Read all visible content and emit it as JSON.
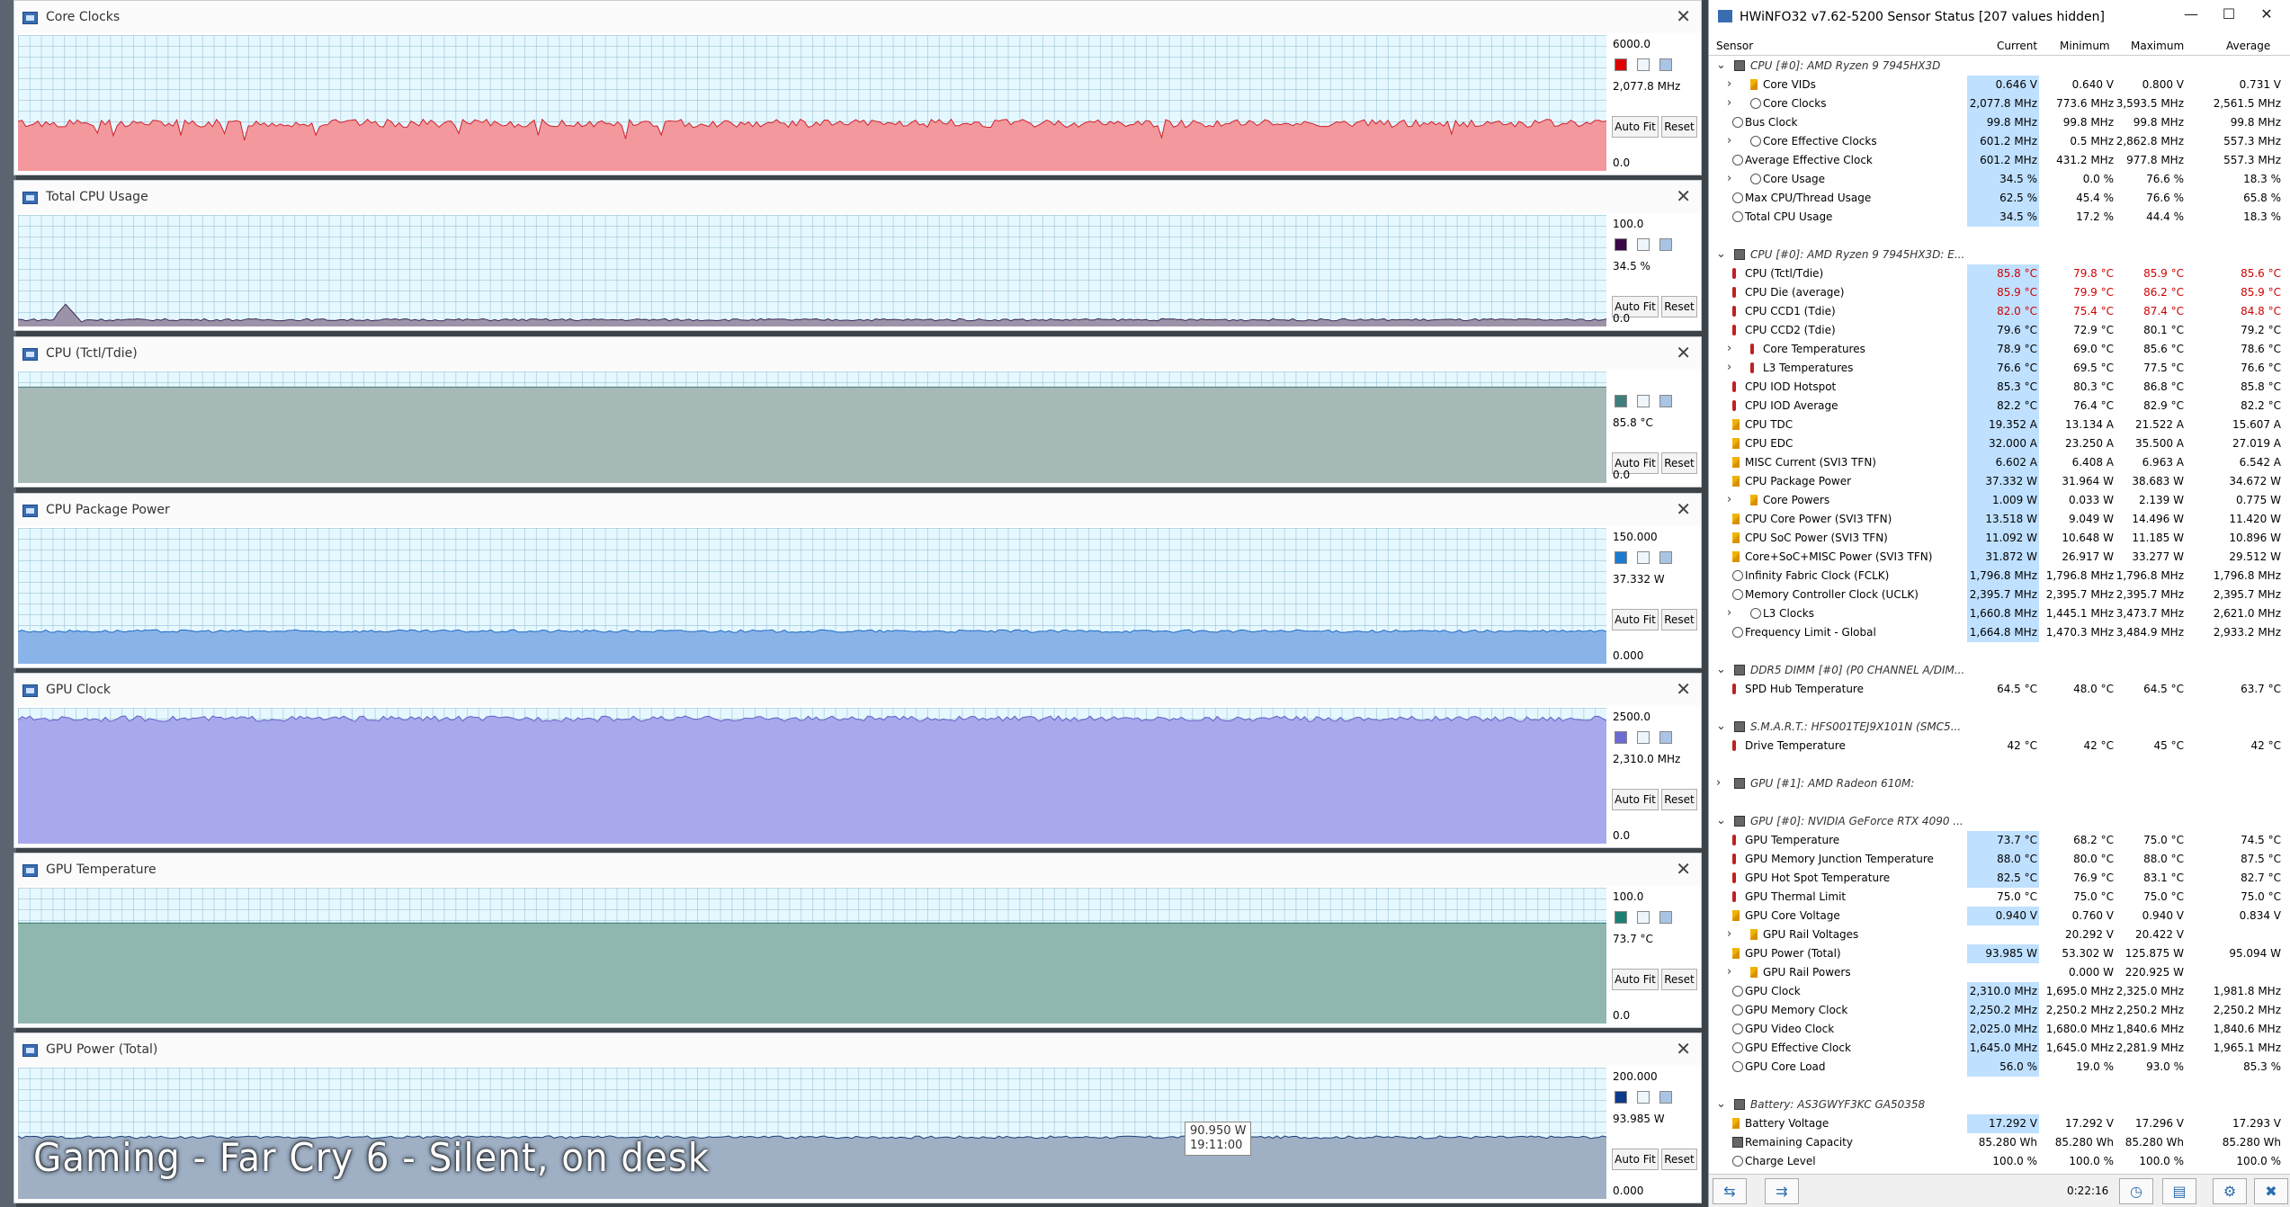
{
  "graphs": [
    {
      "title": "Core Clocks",
      "max": "6000.0",
      "current": "2,077.8 MHz",
      "min": "0.0",
      "fill": "#f3999d",
      "line": "#d0212b",
      "swatch": "#e00000",
      "level": 0.35,
      "noise": 0.03
    },
    {
      "title": "Total CPU Usage",
      "max": "100.0",
      "current": "34.5 %",
      "min": "0.0",
      "fill": "#9d93a8",
      "line": "#3a2a58",
      "swatch": "#3a0845",
      "level": 0.06,
      "noise": 0.01
    },
    {
      "title": "CPU (Tctl/Tdie)",
      "max": "",
      "current": "85.8 °C",
      "min": "0.0",
      "fill": "#a6b9b6",
      "line": "#4a7a73",
      "swatch": "#3e7f7c",
      "level": 0.86,
      "noise": 0.0
    },
    {
      "title": "CPU Package Power",
      "max": "150.000",
      "current": "37.332 W",
      "min": "0.000",
      "fill": "#8ab3e8",
      "line": "#1c6ac8",
      "swatch": "#1c7ad0",
      "level": 0.24,
      "noise": 0.01
    },
    {
      "title": "GPU Clock",
      "max": "2500.0",
      "current": "2,310.0 MHz",
      "min": "0.0",
      "fill": "#a8a8ec",
      "line": "#6060c8",
      "swatch": "#6b6bd0",
      "level": 0.92,
      "noise": 0.02
    },
    {
      "title": "GPU Temperature",
      "max": "100.0",
      "current": "73.7 °C",
      "min": "0.0",
      "fill": "#8fb6af",
      "line": "#2b7a6a",
      "swatch": "#1e8074",
      "level": 0.74,
      "noise": 0.0
    },
    {
      "title": "GPU Power (Total)",
      "max": "200.000",
      "current": "93.985 W",
      "min": "0.000",
      "fill": "#9fb0c5",
      "line": "#1a3f7a",
      "swatch": "#0d3a8a",
      "level": 0.47,
      "noise": 0.01
    }
  ],
  "buttons": {
    "autofit": "Auto Fit",
    "reset": "Reset"
  },
  "tooltip": {
    "value": "90.950 W",
    "time": "19:11:00"
  },
  "caption": "Gaming - Far Cry 6 - Silent, on desk",
  "hwinfo": {
    "title": "HWiNFO32 v7.62-5200 Sensor Status [207 values hidden]",
    "columns": {
      "sensor": "Sensor",
      "current": "Current",
      "minimum": "Minimum",
      "maximum": "Maximum",
      "average": "Average"
    },
    "timer": "0:22:16",
    "rows": [
      {
        "t": "g",
        "name": "CPU [#0]: AMD Ryzen 9 7945HX3D"
      },
      {
        "i": "volt",
        "x": 1,
        "name": "Core VIDs",
        "cur": "0.646 V",
        "min": "0.640 V",
        "max": "0.800 V",
        "avg": "0.731 V"
      },
      {
        "i": "clock",
        "x": 1,
        "name": "Core Clocks",
        "cur": "2,077.8 MHz",
        "min": "773.6 MHz",
        "max": "3,593.5 MHz",
        "avg": "2,561.5 MHz"
      },
      {
        "i": "clock",
        "name": "Bus Clock",
        "cur": "99.8 MHz",
        "min": "99.8 MHz",
        "max": "99.8 MHz",
        "avg": "99.8 MHz"
      },
      {
        "i": "clock",
        "x": 1,
        "name": "Core Effective Clocks",
        "cur": "601.2 MHz",
        "min": "0.5 MHz",
        "max": "2,862.8 MHz",
        "avg": "557.3 MHz"
      },
      {
        "i": "clock",
        "name": "Average Effective Clock",
        "cur": "601.2 MHz",
        "min": "431.2 MHz",
        "max": "977.8 MHz",
        "avg": "557.3 MHz"
      },
      {
        "i": "clock",
        "x": 1,
        "name": "Core Usage",
        "cur": "34.5 %",
        "min": "0.0 %",
        "max": "76.6 %",
        "avg": "18.3 %"
      },
      {
        "i": "clock",
        "name": "Max CPU/Thread Usage",
        "cur": "62.5 %",
        "min": "45.4 %",
        "max": "76.6 %",
        "avg": "65.8 %"
      },
      {
        "i": "clock",
        "name": "Total CPU Usage",
        "cur": "34.5 %",
        "min": "17.2 %",
        "max": "44.4 %",
        "avg": "18.3 %"
      },
      {
        "t": "s"
      },
      {
        "t": "g",
        "name": "CPU [#0]: AMD Ryzen 9 7945HX3D: E..."
      },
      {
        "i": "therm",
        "name": "CPU (Tctl/Tdie)",
        "cur": "85.8 °C",
        "min": "79.8 °C",
        "max": "85.9 °C",
        "avg": "85.6 °C",
        "red": 1
      },
      {
        "i": "therm",
        "name": "CPU Die (average)",
        "cur": "85.9 °C",
        "min": "79.9 °C",
        "max": "86.2 °C",
        "avg": "85.9 °C",
        "red": 1
      },
      {
        "i": "therm",
        "name": "CPU CCD1 (Tdie)",
        "cur": "82.0 °C",
        "min": "75.4 °C",
        "max": "87.4 °C",
        "avg": "84.8 °C",
        "red": 1
      },
      {
        "i": "therm",
        "name": "CPU CCD2 (Tdie)",
        "cur": "79.6 °C",
        "min": "72.9 °C",
        "max": "80.1 °C",
        "avg": "79.2 °C"
      },
      {
        "i": "therm",
        "x": 1,
        "name": "Core Temperatures",
        "cur": "78.9 °C",
        "min": "69.0 °C",
        "max": "85.6 °C",
        "avg": "78.6 °C"
      },
      {
        "i": "therm",
        "x": 1,
        "name": "L3 Temperatures",
        "cur": "76.6 °C",
        "min": "69.5 °C",
        "max": "77.5 °C",
        "avg": "76.6 °C"
      },
      {
        "i": "therm",
        "name": "CPU IOD Hotspot",
        "cur": "85.3 °C",
        "min": "80.3 °C",
        "max": "86.8 °C",
        "avg": "85.8 °C"
      },
      {
        "i": "therm",
        "name": "CPU IOD Average",
        "cur": "82.2 °C",
        "min": "76.4 °C",
        "max": "82.9 °C",
        "avg": "82.2 °C"
      },
      {
        "i": "volt",
        "name": "CPU TDC",
        "cur": "19.352 A",
        "min": "13.134 A",
        "max": "21.522 A",
        "avg": "15.607 A"
      },
      {
        "i": "volt",
        "name": "CPU EDC",
        "cur": "32.000 A",
        "min": "23.250 A",
        "max": "35.500 A",
        "avg": "27.019 A"
      },
      {
        "i": "volt",
        "name": "MISC Current (SVI3 TFN)",
        "cur": "6.602 A",
        "min": "6.408 A",
        "max": "6.963 A",
        "avg": "6.542 A"
      },
      {
        "i": "volt",
        "name": "CPU Package Power",
        "cur": "37.332 W",
        "min": "31.964 W",
        "max": "38.683 W",
        "avg": "34.672 W"
      },
      {
        "i": "volt",
        "x": 1,
        "name": "Core Powers",
        "cur": "1.009 W",
        "min": "0.033 W",
        "max": "2.139 W",
        "avg": "0.775 W"
      },
      {
        "i": "volt",
        "name": "CPU Core Power (SVI3 TFN)",
        "cur": "13.518 W",
        "min": "9.049 W",
        "max": "14.496 W",
        "avg": "11.420 W"
      },
      {
        "i": "volt",
        "name": "CPU SoC Power (SVI3 TFN)",
        "cur": "11.092 W",
        "min": "10.648 W",
        "max": "11.185 W",
        "avg": "10.896 W"
      },
      {
        "i": "volt",
        "name": "Core+SoC+MISC Power (SVI3 TFN)",
        "cur": "31.872 W",
        "min": "26.917 W",
        "max": "33.277 W",
        "avg": "29.512 W"
      },
      {
        "i": "clock",
        "name": "Infinity Fabric Clock (FCLK)",
        "cur": "1,796.8 MHz",
        "min": "1,796.8 MHz",
        "max": "1,796.8 MHz",
        "avg": "1,796.8 MHz"
      },
      {
        "i": "clock",
        "name": "Memory Controller Clock (UCLK)",
        "cur": "2,395.7 MHz",
        "min": "2,395.7 MHz",
        "max": "2,395.7 MHz",
        "avg": "2,395.7 MHz"
      },
      {
        "i": "clock",
        "x": 1,
        "name": "L3 Clocks",
        "cur": "1,660.8 MHz",
        "min": "1,445.1 MHz",
        "max": "3,473.7 MHz",
        "avg": "2,621.0 MHz"
      },
      {
        "i": "clock",
        "name": "Frequency Limit - Global",
        "cur": "1,664.8 MHz",
        "min": "1,470.3 MHz",
        "max": "3,484.9 MHz",
        "avg": "2,933.2 MHz"
      },
      {
        "t": "s"
      },
      {
        "t": "g",
        "name": "DDR5 DIMM [#0] (P0 CHANNEL A/DIM..."
      },
      {
        "i": "therm",
        "name": "SPD Hub Temperature",
        "cur": "64.5 °C",
        "min": "48.0 °C",
        "max": "64.5 °C",
        "avg": "63.7 °C",
        "nobg": 1
      },
      {
        "t": "s"
      },
      {
        "t": "g",
        "name": "S.M.A.R.T.: HFS001TEJ9X101N (SMC5..."
      },
      {
        "i": "therm",
        "name": "Drive Temperature",
        "cur": "42 °C",
        "min": "42 °C",
        "max": "45 °C",
        "avg": "42 °C",
        "nobg": 1
      },
      {
        "t": "s"
      },
      {
        "t": "gc",
        "name": "GPU [#1]: AMD Radeon 610M:"
      },
      {
        "t": "s"
      },
      {
        "t": "g",
        "name": "GPU [#0]: NVIDIA GeForce RTX 4090 ..."
      },
      {
        "i": "therm",
        "name": "GPU Temperature",
        "cur": "73.7 °C",
        "min": "68.2 °C",
        "max": "75.0 °C",
        "avg": "74.5 °C"
      },
      {
        "i": "therm",
        "name": "GPU Memory Junction Temperature",
        "cur": "88.0 °C",
        "min": "80.0 °C",
        "max": "88.0 °C",
        "avg": "87.5 °C"
      },
      {
        "i": "therm",
        "name": "GPU Hot Spot Temperature",
        "cur": "82.5 °C",
        "min": "76.9 °C",
        "max": "83.1 °C",
        "avg": "82.7 °C"
      },
      {
        "i": "therm",
        "name": "GPU Thermal Limit",
        "cur": "75.0 °C",
        "min": "75.0 °C",
        "max": "75.0 °C",
        "avg": "75.0 °C",
        "nobg": 1
      },
      {
        "i": "volt",
        "name": "GPU Core Voltage",
        "cur": "0.940 V",
        "min": "0.760 V",
        "max": "0.940 V",
        "avg": "0.834 V"
      },
      {
        "i": "volt",
        "x": 1,
        "name": "GPU Rail Voltages",
        "cur": "",
        "min": "20.292 V",
        "max": "20.422 V",
        "avg": ""
      },
      {
        "i": "volt",
        "name": "GPU Power (Total)",
        "cur": "93.985 W",
        "min": "53.302 W",
        "max": "125.875 W",
        "avg": "95.094 W"
      },
      {
        "i": "volt",
        "x": 1,
        "name": "GPU Rail Powers",
        "cur": "",
        "min": "0.000 W",
        "max": "220.925 W",
        "avg": ""
      },
      {
        "i": "clock",
        "name": "GPU Clock",
        "cur": "2,310.0 MHz",
        "min": "1,695.0 MHz",
        "max": "2,325.0 MHz",
        "avg": "1,981.8 MHz"
      },
      {
        "i": "clock",
        "name": "GPU Memory Clock",
        "cur": "2,250.2 MHz",
        "min": "2,250.2 MHz",
        "max": "2,250.2 MHz",
        "avg": "2,250.2 MHz"
      },
      {
        "i": "clock",
        "name": "GPU Video Clock",
        "cur": "2,025.0 MHz",
        "min": "1,680.0 MHz",
        "max": "1,840.6 MHz",
        "avg": "1,840.6 MHz"
      },
      {
        "i": "clock",
        "name": "GPU Effective Clock",
        "cur": "1,645.0 MHz",
        "min": "1,645.0 MHz",
        "max": "2,281.9 MHz",
        "avg": "1,965.1 MHz"
      },
      {
        "i": "clock",
        "name": "GPU Core Load",
        "cur": "56.0 %",
        "min": "19.0 %",
        "max": "93.0 %",
        "avg": "85.3 %"
      },
      {
        "t": "s"
      },
      {
        "t": "g",
        "name": "Battery: AS3GWYF3KC GA50358"
      },
      {
        "i": "volt",
        "name": "Battery Voltage",
        "cur": "17.292 V",
        "min": "17.292 V",
        "max": "17.296 V",
        "avg": "17.293 V"
      },
      {
        "i": "chip",
        "name": "Remaining Capacity",
        "cur": "85.280 Wh",
        "min": "85.280 Wh",
        "max": "85.280 Wh",
        "avg": "85.280 Wh",
        "nobg": 1
      },
      {
        "i": "clock",
        "name": "Charge Level",
        "cur": "100.0 %",
        "min": "100.0 %",
        "max": "100.0 %",
        "avg": "100.0 %",
        "nobg": 1
      }
    ]
  }
}
